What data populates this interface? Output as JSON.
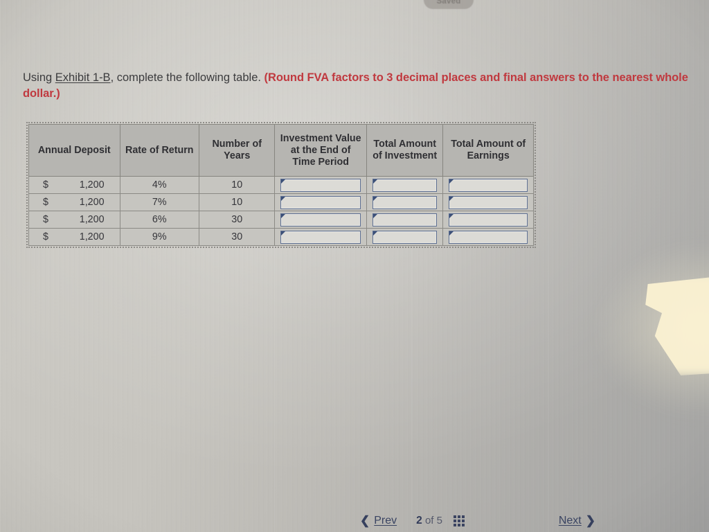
{
  "status": {
    "saved_label": "Saved"
  },
  "instruction": {
    "prefix": "Using ",
    "link_text": "Exhibit 1-B",
    "middle": ", complete the following table. ",
    "warning": "(Round FVA factors to 3 decimal places and final answers to the nearest whole dollar.)"
  },
  "table": {
    "headers": [
      "Annual Deposit",
      "Rate of Return",
      "Number of Years",
      "Investment Value at the End of Time Period",
      "Total Amount of Investment",
      "Total Amount of Earnings"
    ],
    "rows": [
      {
        "currency": "$",
        "annual_deposit": "1,200",
        "rate_of_return": "4%",
        "number_of_years": "10",
        "investment_value_end": "",
        "total_amount_investment": "",
        "total_amount_earnings": ""
      },
      {
        "currency": "$",
        "annual_deposit": "1,200",
        "rate_of_return": "7%",
        "number_of_years": "10",
        "investment_value_end": "",
        "total_amount_investment": "",
        "total_amount_earnings": ""
      },
      {
        "currency": "$",
        "annual_deposit": "1,200",
        "rate_of_return": "6%",
        "number_of_years": "30",
        "investment_value_end": "",
        "total_amount_investment": "",
        "total_amount_earnings": ""
      },
      {
        "currency": "$",
        "annual_deposit": "1,200",
        "rate_of_return": "9%",
        "number_of_years": "30",
        "investment_value_end": "",
        "total_amount_investment": "",
        "total_amount_earnings": ""
      }
    ]
  },
  "navigation": {
    "prev_label": "Prev",
    "prev_icon": "chevron-left-icon",
    "current_page": "2",
    "page_separator": "of",
    "total_pages": "5",
    "grid_icon": "grid-menu-icon",
    "next_label": "Next",
    "next_icon": "chevron-right-icon"
  },
  "colors": {
    "warning_red": "#c0393f",
    "nav_blue": "#36405e",
    "input_border_blue": "#5d6f92",
    "header_gray": "#b6b5b1"
  }
}
